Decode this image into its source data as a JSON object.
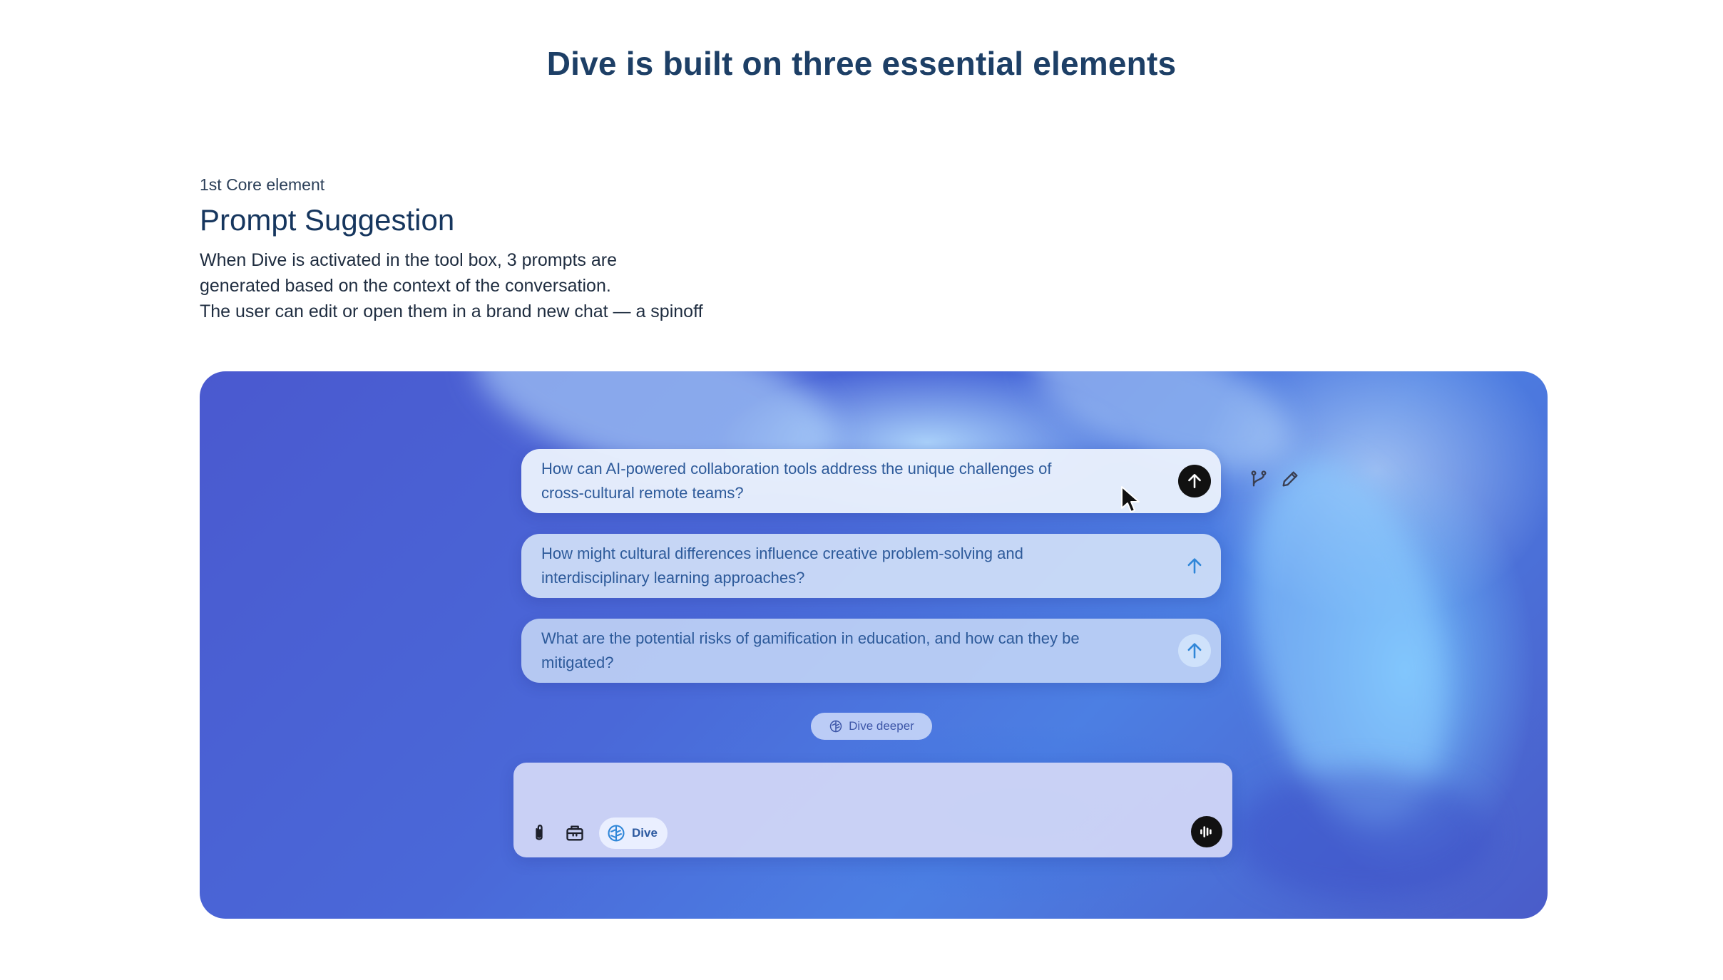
{
  "page": {
    "title": "Dive is built on three essential elements"
  },
  "intro": {
    "eyebrow": "1st Core element",
    "heading": "Prompt Suggestion",
    "description_lines": [
      "When Dive is activated in the tool box, 3 prompts are",
      "generated based on the context of the conversation.",
      "The user can edit or open them in a brand new chat — a spinoff"
    ]
  },
  "suggestions": [
    {
      "lines": [
        "How can AI-powered collaboration tools address the unique challenges of",
        "cross-cultural remote teams?"
      ],
      "send_icon": "arrow-up-icon",
      "send_style": "dark"
    },
    {
      "lines": [
        "How might cultural differences influence creative problem-solving and",
        "interdisciplinary learning approaches?"
      ],
      "send_icon": "arrow-up-icon",
      "send_style": "light"
    },
    {
      "lines": [
        "What are the potential risks of gamification in education, and how can they be",
        "mitigated?"
      ],
      "send_icon": "arrow-up-icon",
      "send_style": "light-ring"
    }
  ],
  "side_tools": {
    "icons": [
      "branch-icon",
      "pencil-icon"
    ]
  },
  "dive_deeper": {
    "label": "Dive deeper",
    "icon": "brain-icon"
  },
  "composer": {
    "placeholder": "",
    "tools": [
      "paperclip-icon",
      "toolbox-icon"
    ],
    "dive_chip_label": "Dive",
    "dive_chip_icon": "brain-icon",
    "voice_icon": "voice-waveform-icon"
  },
  "colors": {
    "title": "#1d3f66",
    "suggestion_text": "#2d5a9a",
    "stage_base": "#4a62d4",
    "send_dark": "#111111",
    "accent_blue": "#2f86d8"
  }
}
